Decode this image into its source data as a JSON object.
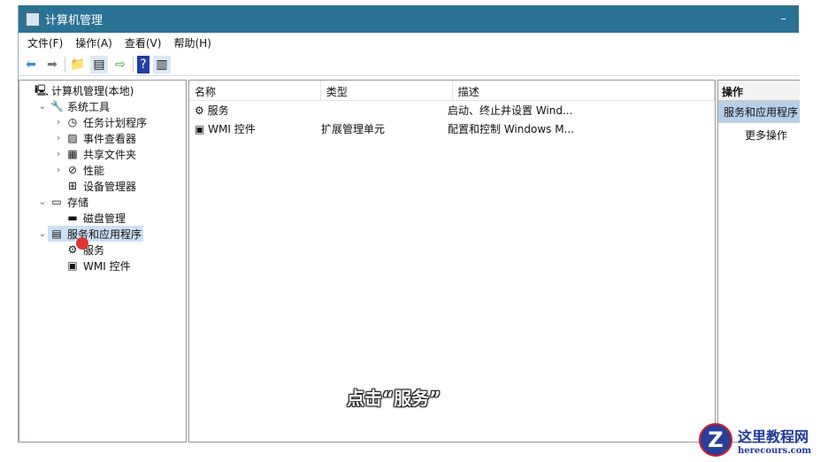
{
  "window": {
    "title": "计算机管理"
  },
  "menu": [
    "文件(F)",
    "操作(A)",
    "查看(V)",
    "帮助(H)"
  ],
  "tree": [
    {
      "label": "计算机管理(本地)",
      "icon": "computer-icon",
      "level": 0,
      "arrow": ""
    },
    {
      "label": "系统工具",
      "icon": "tools-icon",
      "level": 1,
      "arrow": "⌄"
    },
    {
      "label": "任务计划程序",
      "icon": "clock-icon",
      "level": 2,
      "arrow": "›"
    },
    {
      "label": "事件查看器",
      "icon": "event-viewer-icon",
      "level": 2,
      "arrow": "›"
    },
    {
      "label": "共享文件夹",
      "icon": "shared-folder-icon",
      "level": 2,
      "arrow": "›"
    },
    {
      "label": "性能",
      "icon": "performance-icon",
      "level": 2,
      "arrow": "›"
    },
    {
      "label": "设备管理器",
      "icon": "device-manager-icon",
      "level": 2,
      "arrow": ""
    },
    {
      "label": "存储",
      "icon": "storage-icon",
      "level": 1,
      "arrow": "⌄"
    },
    {
      "label": "磁盘管理",
      "icon": "disk-icon",
      "level": 2,
      "arrow": ""
    },
    {
      "label": "服务和应用程序",
      "icon": "services-apps-icon",
      "level": 1,
      "arrow": "⌄",
      "selected": true
    },
    {
      "label": "服务",
      "icon": "gear-icon",
      "level": 2,
      "arrow": ""
    },
    {
      "label": "WMI 控件",
      "icon": "wmi-icon",
      "level": 2,
      "arrow": ""
    }
  ],
  "list": {
    "headers": [
      "名称",
      "类型",
      "描述"
    ],
    "rows": [
      {
        "name": "服务",
        "type": "",
        "desc": "启动、终止并设置 Wind..."
      },
      {
        "name": "WMI 控件",
        "type": "扩展管理单元",
        "desc": "配置和控制 Windows M..."
      }
    ]
  },
  "actions": {
    "header": "操作",
    "section": "服务和应用程序",
    "more": "更多操作"
  },
  "caption": "点击“服务”",
  "watermark": {
    "title": "这里教程网",
    "url": "herecours.com"
  }
}
